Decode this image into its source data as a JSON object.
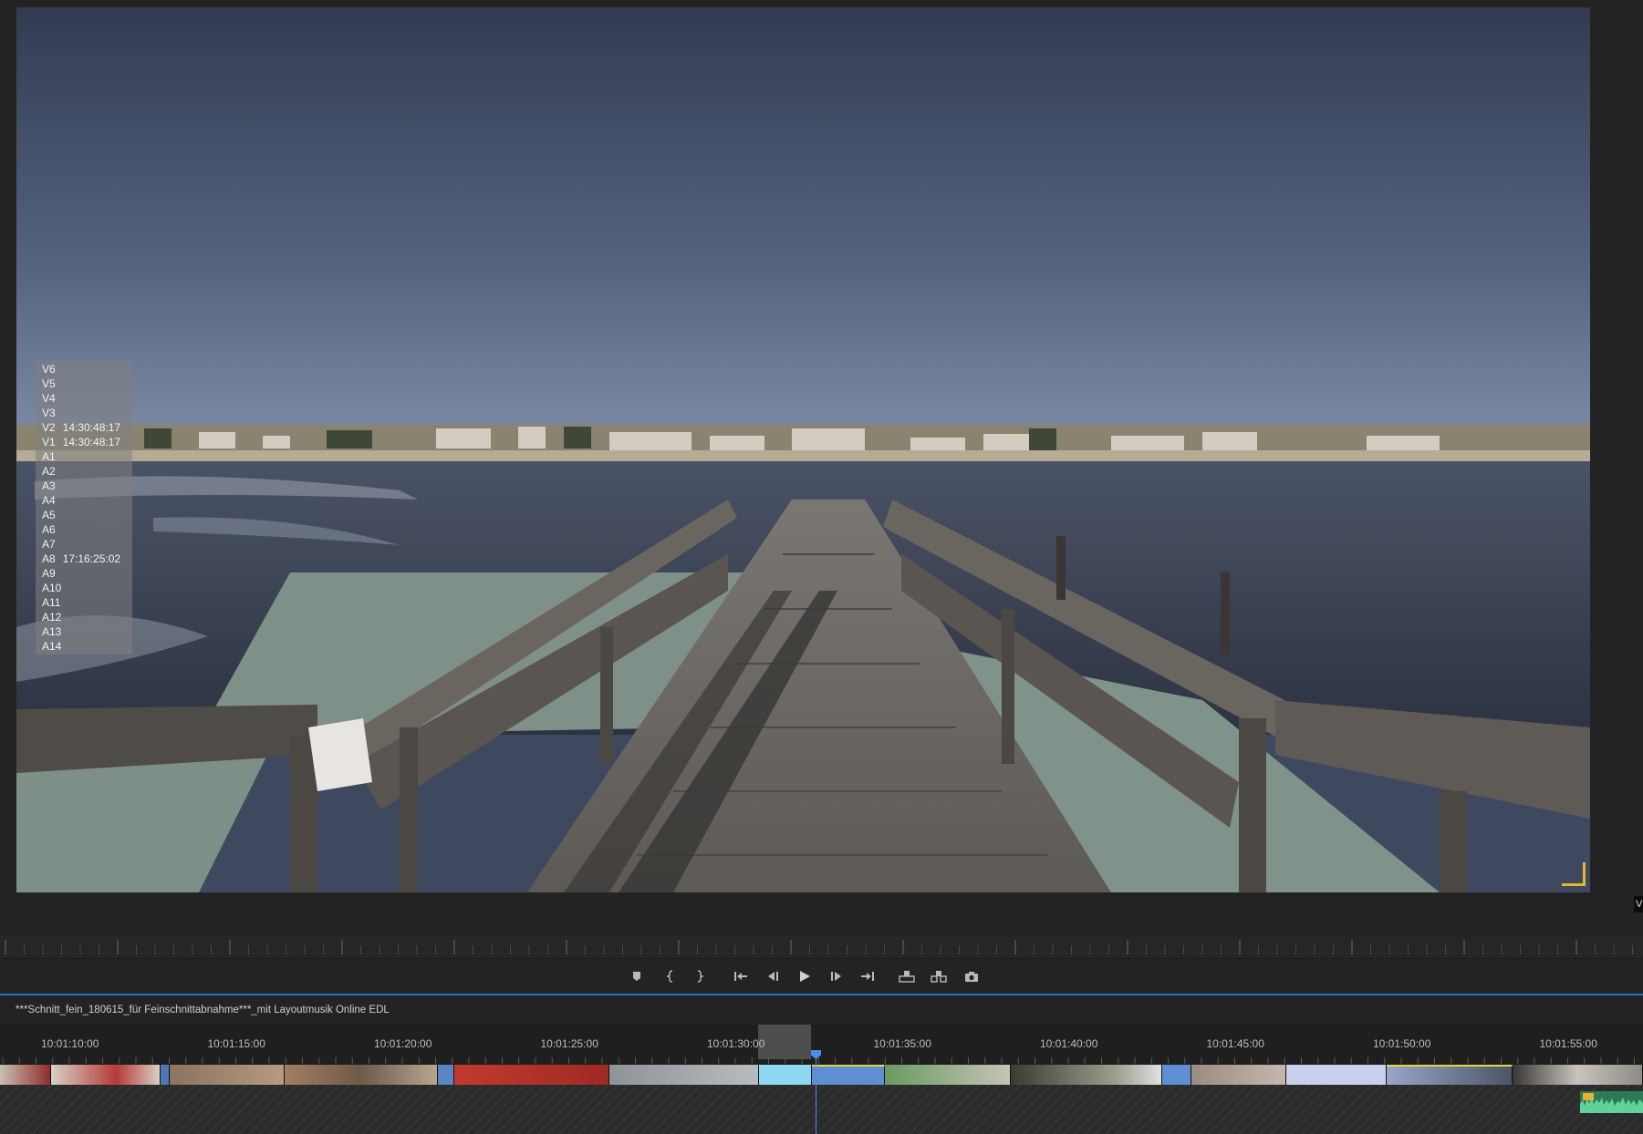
{
  "monitor": {
    "track_overlay": [
      {
        "track": "V6",
        "timecode": ""
      },
      {
        "track": "V5",
        "timecode": ""
      },
      {
        "track": "V4",
        "timecode": ""
      },
      {
        "track": "V3",
        "timecode": ""
      },
      {
        "track": "V2",
        "timecode": "14:30:48:17"
      },
      {
        "track": "V1",
        "timecode": "14:30:48:17"
      },
      {
        "track": "A1",
        "timecode": ""
      },
      {
        "track": "A2",
        "timecode": ""
      },
      {
        "track": "A3",
        "timecode": ""
      },
      {
        "track": "A4",
        "timecode": ""
      },
      {
        "track": "A5",
        "timecode": ""
      },
      {
        "track": "A6",
        "timecode": ""
      },
      {
        "track": "A7",
        "timecode": ""
      },
      {
        "track": "A8",
        "timecode": "17:16:25:02"
      },
      {
        "track": "A9",
        "timecode": ""
      },
      {
        "track": "A10",
        "timecode": ""
      },
      {
        "track": "A11",
        "timecode": ""
      },
      {
        "track": "A12",
        "timecode": ""
      },
      {
        "track": "A13",
        "timecode": ""
      },
      {
        "track": "A14",
        "timecode": ""
      }
    ],
    "edge_label": "V",
    "safe_margin_color": "#e8b627"
  },
  "transport": {
    "buttons": [
      {
        "name": "add-marker-button",
        "icon": "marker-icon"
      },
      {
        "name": "mark-in-button",
        "icon": "mark-in-icon"
      },
      {
        "name": "mark-out-button",
        "icon": "mark-out-icon"
      },
      {
        "name": "go-to-in-button",
        "icon": "go-to-in-icon"
      },
      {
        "name": "step-back-button",
        "icon": "step-back-icon"
      },
      {
        "name": "play-button",
        "icon": "play-icon"
      },
      {
        "name": "step-forward-button",
        "icon": "step-forward-icon"
      },
      {
        "name": "go-to-out-button",
        "icon": "go-to-out-icon"
      },
      {
        "name": "lift-button",
        "icon": "lift-icon"
      },
      {
        "name": "extract-button",
        "icon": "extract-icon"
      },
      {
        "name": "export-frame-button",
        "icon": "camera-icon"
      }
    ]
  },
  "sequence": {
    "title": "***Schnitt_fein_180615_für Feinschnittabnahme***_mit Layoutmusik Online EDL",
    "ruler_labels": [
      "10:01:10:00",
      "10:01:15:00",
      "10:01:20:00",
      "10:01:25:00",
      "10:01:30:00",
      "10:01:35:00",
      "10:01:40:00",
      "10:01:45:00",
      "10:01:50:00",
      "10:01:55:00"
    ],
    "playhead_timecode": "10:01:32:07",
    "accent_color": "#2e6ebf",
    "playhead_color": "#4a8fe6",
    "audio_clip_color": "#2c7a5a"
  }
}
